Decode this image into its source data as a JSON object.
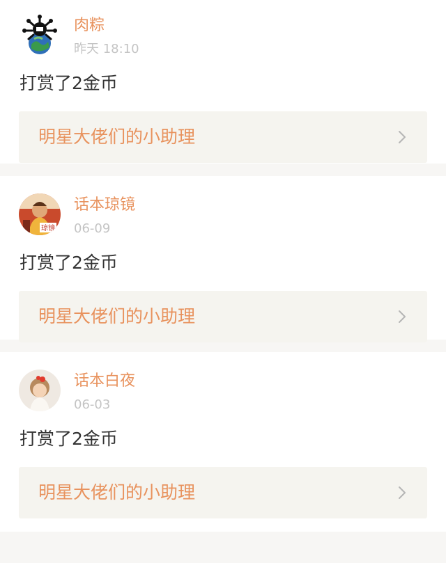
{
  "items": [
    {
      "username": "肉粽",
      "time": "昨天 18:10",
      "message": "打赏了2金币",
      "link_text": "明星大佬们的小助理",
      "avatar_icon": "virus-globe-icon"
    },
    {
      "username": "话本琼镜",
      "time": "06-09",
      "message": "打赏了2金币",
      "link_text": "明星大佬们的小助理",
      "avatar_icon": "portrait-avatar-icon",
      "avatar_badge": "琼镜"
    },
    {
      "username": "话本白夜",
      "time": "06-03",
      "message": "打赏了2金币",
      "link_text": "明星大佬们的小助理",
      "avatar_icon": "girl-photo-avatar-icon"
    }
  ],
  "colors": {
    "accent": "#e8925d",
    "time_gray": "#c4c4c4",
    "text": "#333333",
    "link_bg": "#f5f4ef",
    "divider_bg": "#f7f6f4"
  },
  "icons": {
    "chevron": "chevron-right-icon"
  }
}
